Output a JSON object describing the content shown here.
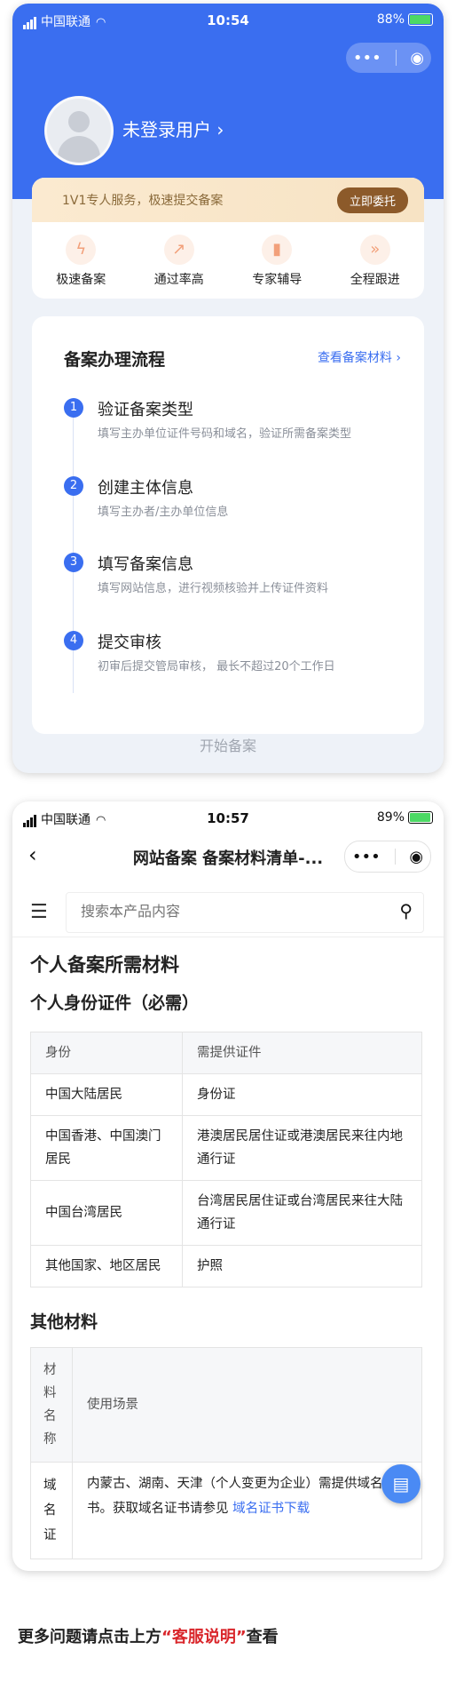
{
  "screen1": {
    "status": {
      "carrier": "中国联通",
      "time": "10:54",
      "battery": "88%",
      "battery_level": 0.88
    },
    "user": {
      "name": "未登录用户 ›"
    },
    "service": {
      "banner_text": "1V1专人服务，极速提交备案",
      "banner_button": "立即委托",
      "features": [
        {
          "label": "极速备案",
          "icon": "lightning-icon"
        },
        {
          "label": "通过率高",
          "icon": "arrow-up-icon"
        },
        {
          "label": "专家辅导",
          "icon": "bookmark-icon"
        },
        {
          "label": "全程跟进",
          "icon": "forward-icon"
        }
      ]
    },
    "flow": {
      "title": "备案办理流程",
      "link": "查看备案材料 ›",
      "steps": [
        {
          "num": "1",
          "title": "验证备案类型",
          "desc": "填写主办单位证件号码和域名，验证所需备案类型"
        },
        {
          "num": "2",
          "title": "创建主体信息",
          "desc": "填写主办者/主办单位信息"
        },
        {
          "num": "3",
          "title": "填写备案信息",
          "desc": "填写网站信息，进行视频核验并上传证件资料"
        },
        {
          "num": "4",
          "title": "提交审核",
          "desc": "初审后提交管局审核， 最长不超过20个工作日"
        }
      ]
    },
    "start_button": "开始备案"
  },
  "screen2": {
    "status": {
      "carrier": "中国联通",
      "time": "10:57",
      "battery": "89%",
      "battery_level": 0.89
    },
    "nav_title": "网站备案 备案材料清单-...",
    "search_placeholder": "搜索本产品内容",
    "heading": "个人备案所需材料",
    "subheading": "个人身份证件（必需）",
    "table1": {
      "headers": [
        "身份",
        "需提供证件"
      ],
      "rows": [
        [
          "中国大陆居民",
          "身份证"
        ],
        [
          "中国香港、中国澳门居民",
          "港澳居民居住证或港澳居民来往内地通行证"
        ],
        [
          "中国台湾居民",
          "台湾居民居住证或台湾居民来往大陆通行证"
        ],
        [
          "其他国家、地区居民",
          "护照"
        ]
      ]
    },
    "other_heading": "其他材料",
    "table2": {
      "headers": [
        "材料名称",
        "使用场景"
      ],
      "row_label": "域名证",
      "row_text": "内蒙古、湖南、天津（个人变更为企业）需提供域名证书。获取域名证书请参见",
      "row_link": "域名证书下载"
    }
  },
  "footer": {
    "prefix": "更多问题请点击上方",
    "highlight": "“客服说明”",
    "suffix": "查看"
  },
  "colors": {
    "primary": "#3a6ef0",
    "accent_gold": "#8c5a2a",
    "highlight_red": "#d9262b"
  }
}
